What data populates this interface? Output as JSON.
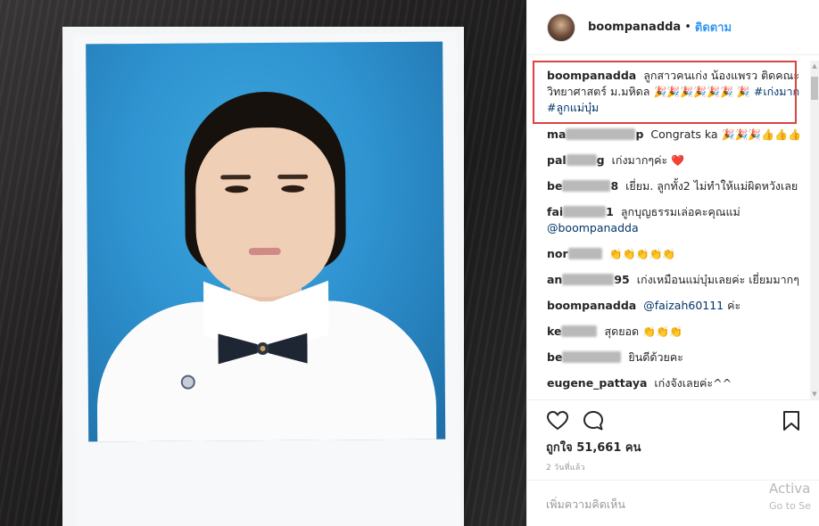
{
  "post": {
    "username": "boompanadda",
    "dot": "•",
    "follow_label": "ติดตาม"
  },
  "caption": {
    "username": "boompanadda",
    "text": "ลูกสาวคนเก่ง น้องแพรว ติดคณะวิทยาศาสตร์ ม.มหิดล",
    "emojis": "🎉🎉🎉🎉🎉🎉 🎉",
    "hashtags": [
      "#เก่งมาก",
      "#ลูกแม่บุ๋ม"
    ]
  },
  "comments": [
    {
      "username_visible": "ma",
      "username_tail": "p",
      "text": "Congrats ka",
      "emojis": "🎉🎉🎉👍👍👍"
    },
    {
      "username_visible": "pal",
      "username_tail": "g",
      "text": "เก่งมากๆค่ะ",
      "emojis": "❤️"
    },
    {
      "username_visible": "be",
      "username_tail": "8",
      "text": "เยี่ยม. ลูกทั้ง2 ไม่ทำให้แม่ผิดหวังเลย",
      "emojis": ""
    },
    {
      "username_visible": "fai",
      "username_tail": "1",
      "text": "ลูกบุญธรรมเล่อคะคุณแม่",
      "mention": "@boompanadda",
      "emojis": ""
    },
    {
      "username_visible": "nor",
      "username_tail": "",
      "text": "",
      "emojis": "👏👏👏👏👏"
    },
    {
      "username_visible": "an",
      "username_tail": "95",
      "text": "เก่งเหมือนแม่บุ๋มเลยค่ะ เยี่ยมมากๆ",
      "emojis": ""
    },
    {
      "username": "boompanadda",
      "mention": "@faizah60111",
      "text": "ค่ะ",
      "emojis": ""
    },
    {
      "username_visible": "ke",
      "username_tail": "",
      "text": "สุดยอด",
      "emojis": "👏👏👏"
    },
    {
      "username_visible": "be",
      "username_tail": "",
      "text": "ยินดีด้วยคะ",
      "emojis": ""
    },
    {
      "username": "eugene_pattaya",
      "text": "เก่งจังเลยค่ะ^^",
      "emojis": ""
    }
  ],
  "actions": {
    "like_icon": "heart-outline-icon",
    "comment_icon": "speech-bubble-icon",
    "save_icon": "bookmark-icon"
  },
  "likes_text": "ถูกใจ 51,661 คน",
  "time_text": "2 วันที่แล้ว",
  "add_comment_placeholder": "เพิ่มความคิดเห็น",
  "watermark": {
    "line1": "Activa",
    "line2": "Go to Se"
  },
  "colors": {
    "link": "#3897f0",
    "mention": "#003569",
    "highlight": "#d9443e"
  }
}
